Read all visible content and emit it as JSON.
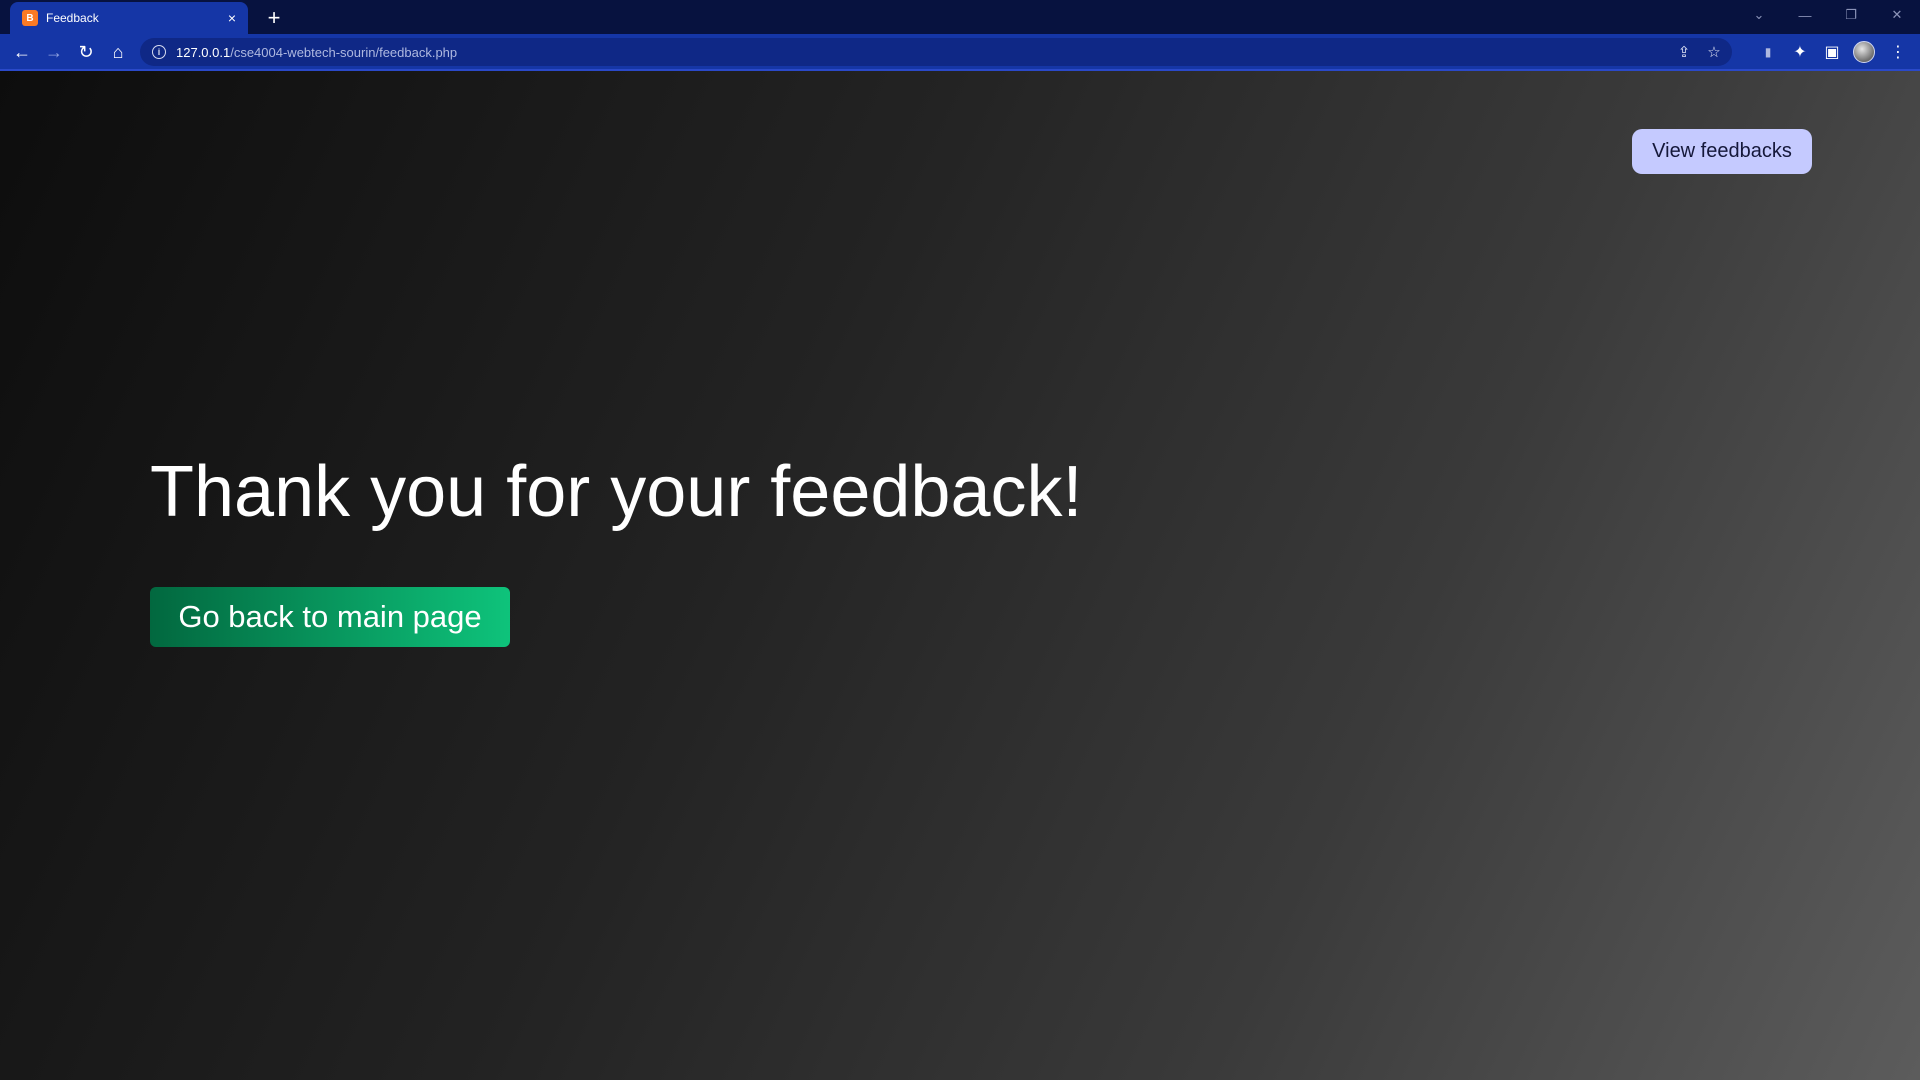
{
  "browser": {
    "tab_title": "Feedback",
    "favicon_label": "B",
    "tab_close": "×",
    "new_tab": "+",
    "url_host": "127.0.0.1",
    "url_path": "/cse4004-webtech-sourin/feedback.php",
    "window_controls": {
      "tabs_menu": "⌄",
      "minimize": "—",
      "restore": "❐",
      "close": "✕"
    },
    "nav": {
      "back": "←",
      "forward": "→",
      "reload": "↻",
      "home": "⌂"
    },
    "toolbar_icons": {
      "share": "⇪",
      "bookmark": "☆",
      "extension_a": "▮",
      "extensions": "✦",
      "side_panel": "▣",
      "menu": "⋮"
    }
  },
  "page": {
    "view_feedbacks_label": "View feedbacks",
    "heading": "Thank you for your feedback!",
    "back_button_label": "Go back to main page"
  },
  "colors": {
    "chrome_tabbar": "#07123f",
    "chrome_toolbar": "#1536a6",
    "view_button_bg": "#c5caff",
    "back_button_start": "#02683f",
    "back_button_end": "#0ec37b"
  }
}
